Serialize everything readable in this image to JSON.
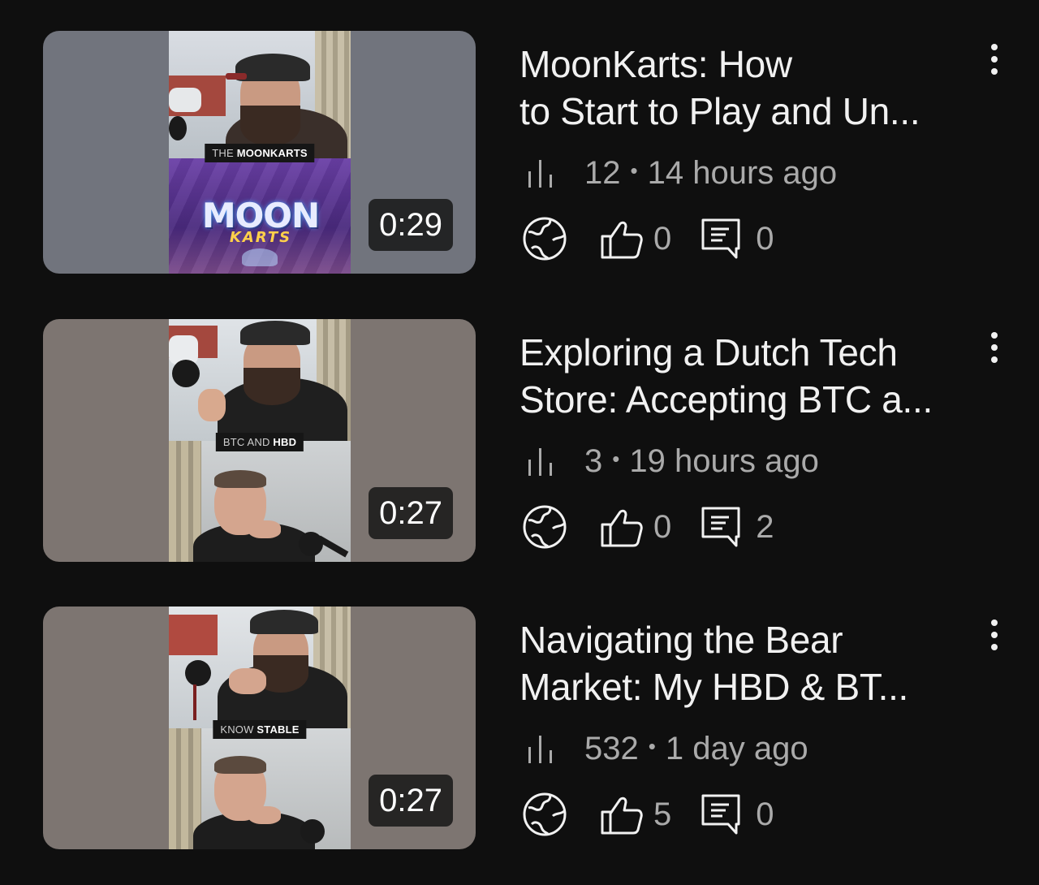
{
  "videos": [
    {
      "title_line1": "MoonKarts: How",
      "title_line2": "to Start to Play and Un...",
      "views": "12",
      "age": "14 hours ago",
      "likes": "0",
      "comments": "0",
      "duration": "0:29",
      "caption_light": "THE",
      "caption_bold": "MOONKARTS",
      "logo_top": "MOON",
      "logo_bottom": "KARTS"
    },
    {
      "title_line1": "Exploring a Dutch Tech",
      "title_line2": "Store: Accepting BTC a...",
      "views": "3",
      "age": "19 hours ago",
      "likes": "0",
      "comments": "2",
      "duration": "0:27",
      "caption_light": "BTC AND",
      "caption_bold": "HBD"
    },
    {
      "title_line1": "Navigating the Bear",
      "title_line2": "Market: My HBD & BT...",
      "views": "532",
      "age": "1 day ago",
      "likes": "5",
      "comments": "0",
      "duration": "0:27",
      "caption_light": "KNOW",
      "caption_bold": "STABLE"
    }
  ],
  "separator": "•",
  "icons": {
    "stats": "bar-chart-icon",
    "visibility": "globe-icon",
    "like": "thumbs-up-icon",
    "comment": "comment-icon",
    "menu": "more-vertical-icon"
  },
  "colors": {
    "background": "#0f0f0f",
    "title": "#f1f1f1",
    "meta": "#aaaaaa",
    "thumb_bg_1": "#71747d",
    "thumb_bg_2": "#7d7571"
  }
}
